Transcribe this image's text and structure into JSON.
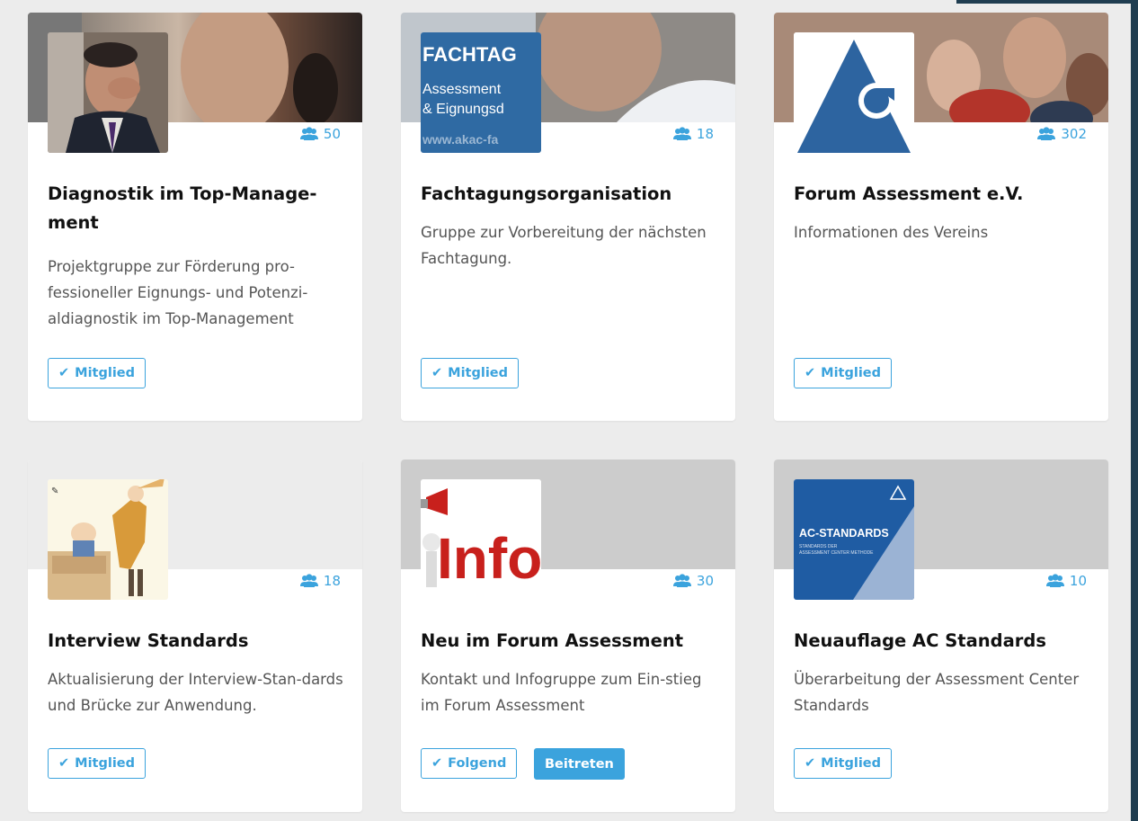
{
  "groups": [
    {
      "title": "Diagnostik im Top-Manage-ment",
      "description": "Projektgruppe zur Förderung pro-fessioneller Eignungs- und Potenzi-aldiagnostik im Top-Management",
      "member_count": "50",
      "membership_label": "Mitglied",
      "thumb_icon": "person-photo-icon"
    },
    {
      "title": "Fachtagungsorganisation",
      "description": "Gruppe zur Vorbereitung der nächsten Fachtagung.",
      "member_count": "18",
      "membership_label": "Mitglied",
      "thumb_icon": "fachtag-logo-icon",
      "thumb_text": [
        "FACHTAG",
        "Assessment",
        "& Eignungsd",
        "www.akac-fa"
      ]
    },
    {
      "title": "Forum Assessment e.V.",
      "description": "Informationen des Vereins",
      "member_count": "302",
      "membership_label": "Mitglied",
      "thumb_icon": "forum-assessment-logo-icon"
    },
    {
      "title": "Interview Standards",
      "description": "Aktualisierung der Interview-Stan-dards und Brücke zur Anwendung.",
      "member_count": "18",
      "membership_label": "Mitglied",
      "thumb_icon": "cartoon-illustration-icon"
    },
    {
      "title": "Neu im Forum Assessment",
      "description": "Kontakt und Infogruppe zum Ein-stieg im Forum Assessment",
      "member_count": "30",
      "membership_label": "Folgend",
      "join_label": "Beitreten",
      "thumb_icon": "info-megaphone-icon",
      "thumb_text": [
        "Info"
      ]
    },
    {
      "title": "Neuauflage AC Standards",
      "description": "Überarbeitung der Assessment Center Standards",
      "member_count": "10",
      "membership_label": "Mitglied",
      "thumb_icon": "ac-standards-cover-icon",
      "thumb_text": [
        "AC-STANDARDS",
        "STANDARDS DER",
        "ASSESSMENT CENTER METHODE"
      ]
    }
  ],
  "colors": {
    "accent": "#3ba3dd",
    "page_background": "#ececec",
    "sidebar": "#1f3d50"
  }
}
